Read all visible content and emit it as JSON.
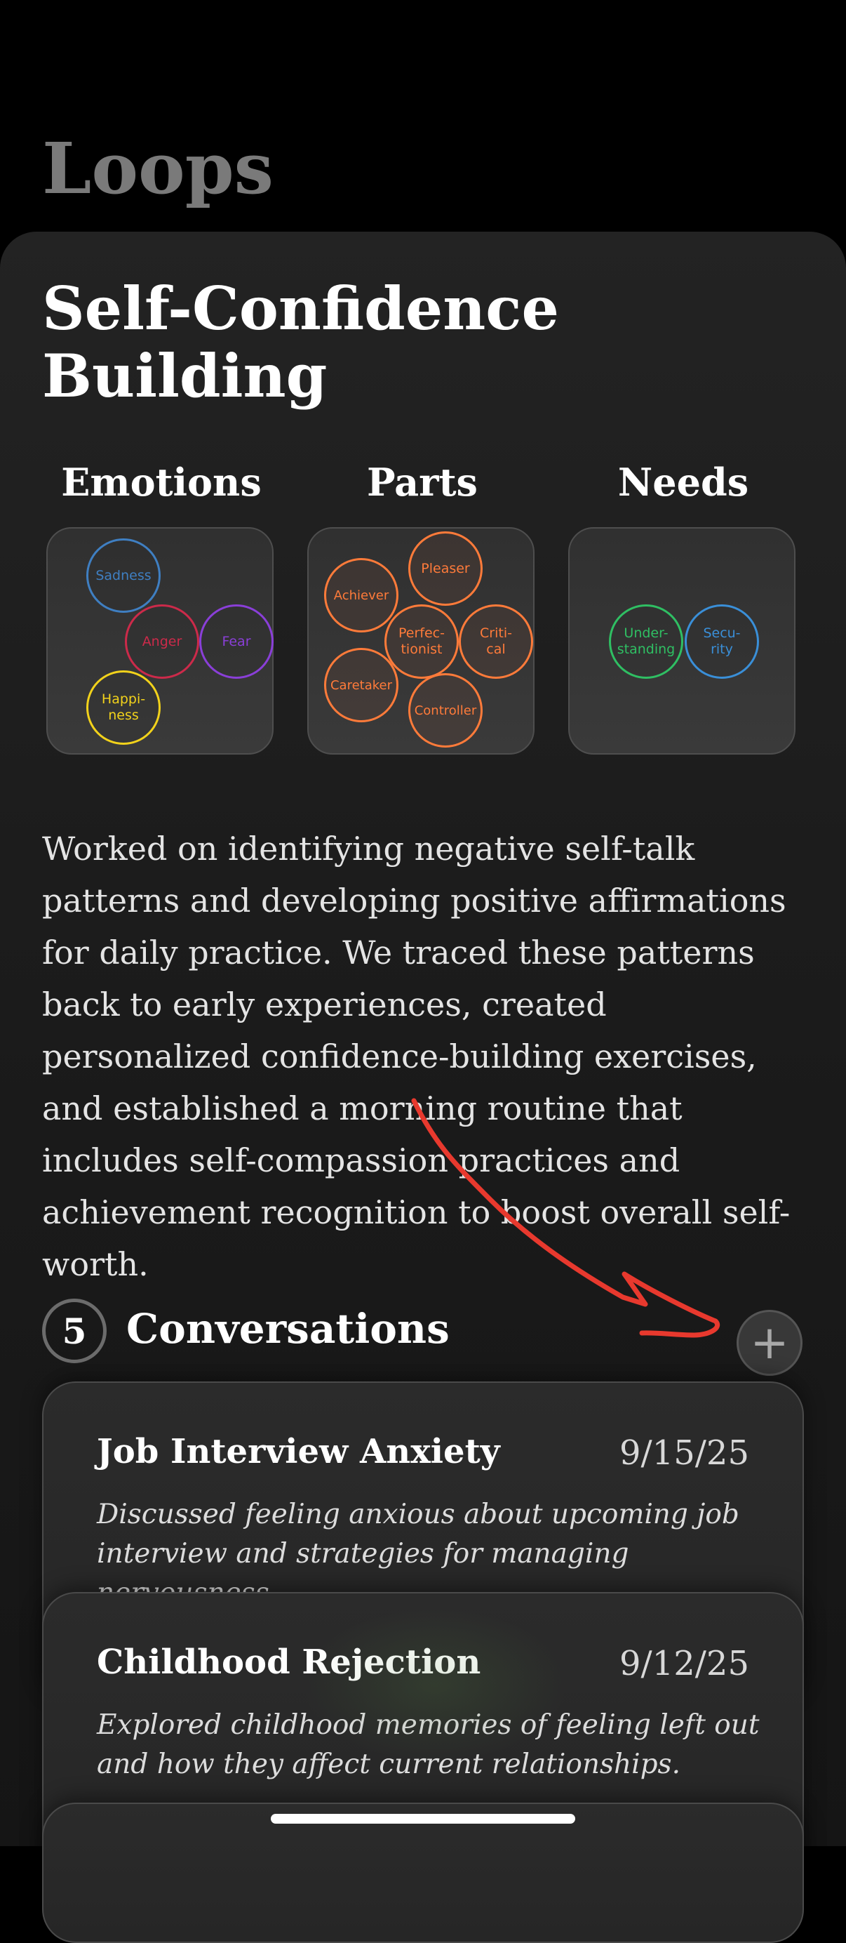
{
  "app": {
    "title": "Loops"
  },
  "loop": {
    "title_line1": "Self-Confidence",
    "title_line2": "Building",
    "summary": "Worked on identifying negative self-talk patterns and developing positive affirmations for daily practice. We traced these patterns back to early experiences, created personalized confidence-building exercises, and established a morning routine that includes self-compassion practices and achievement recognition to boost overall self-worth."
  },
  "columns": {
    "emotions": {
      "label": "Emotions",
      "items": [
        {
          "line1": "Sadness",
          "line2": "",
          "color": "#3f7fc2"
        },
        {
          "line1": "Anger",
          "line2": "",
          "color": "#cc2a4a"
        },
        {
          "line1": "Fear",
          "line2": "",
          "color": "#8a3fd8"
        },
        {
          "line1": "Happi-",
          "line2": "ness",
          "color": "#f2d21b"
        }
      ]
    },
    "parts": {
      "label": "Parts",
      "color": "#ff7b3a",
      "items": [
        {
          "line1": "Pleaser",
          "line2": ""
        },
        {
          "line1": "Achiever",
          "line2": ""
        },
        {
          "line1": "Perfec-",
          "line2": "tionist"
        },
        {
          "line1": "Criti-",
          "line2": "cal"
        },
        {
          "line1": "Caretaker",
          "line2": ""
        },
        {
          "line1": "Controller",
          "line2": ""
        }
      ]
    },
    "needs": {
      "label": "Needs",
      "items": [
        {
          "line1": "Under-",
          "line2": "standing",
          "color": "#2fbf63"
        },
        {
          "line1": "Secu-",
          "line2": "rity",
          "color": "#3a8fd8"
        }
      ]
    }
  },
  "conversations": {
    "count": "5",
    "heading": "Conversations",
    "add_label": "+",
    "items": [
      {
        "title": "Job Interview Anxiety",
        "date": "9/15/25",
        "description": "Discussed feeling anxious about upcoming job interview and strategies for managing nervousness."
      },
      {
        "title": "Childhood Rejection",
        "date": "9/12/25",
        "description": "Explored childhood memories of feeling left out and how they affect current relationships."
      }
    ]
  },
  "colors": {
    "annotation_arrow": "#e8392e",
    "parts_accent": "#ff7b3a"
  }
}
